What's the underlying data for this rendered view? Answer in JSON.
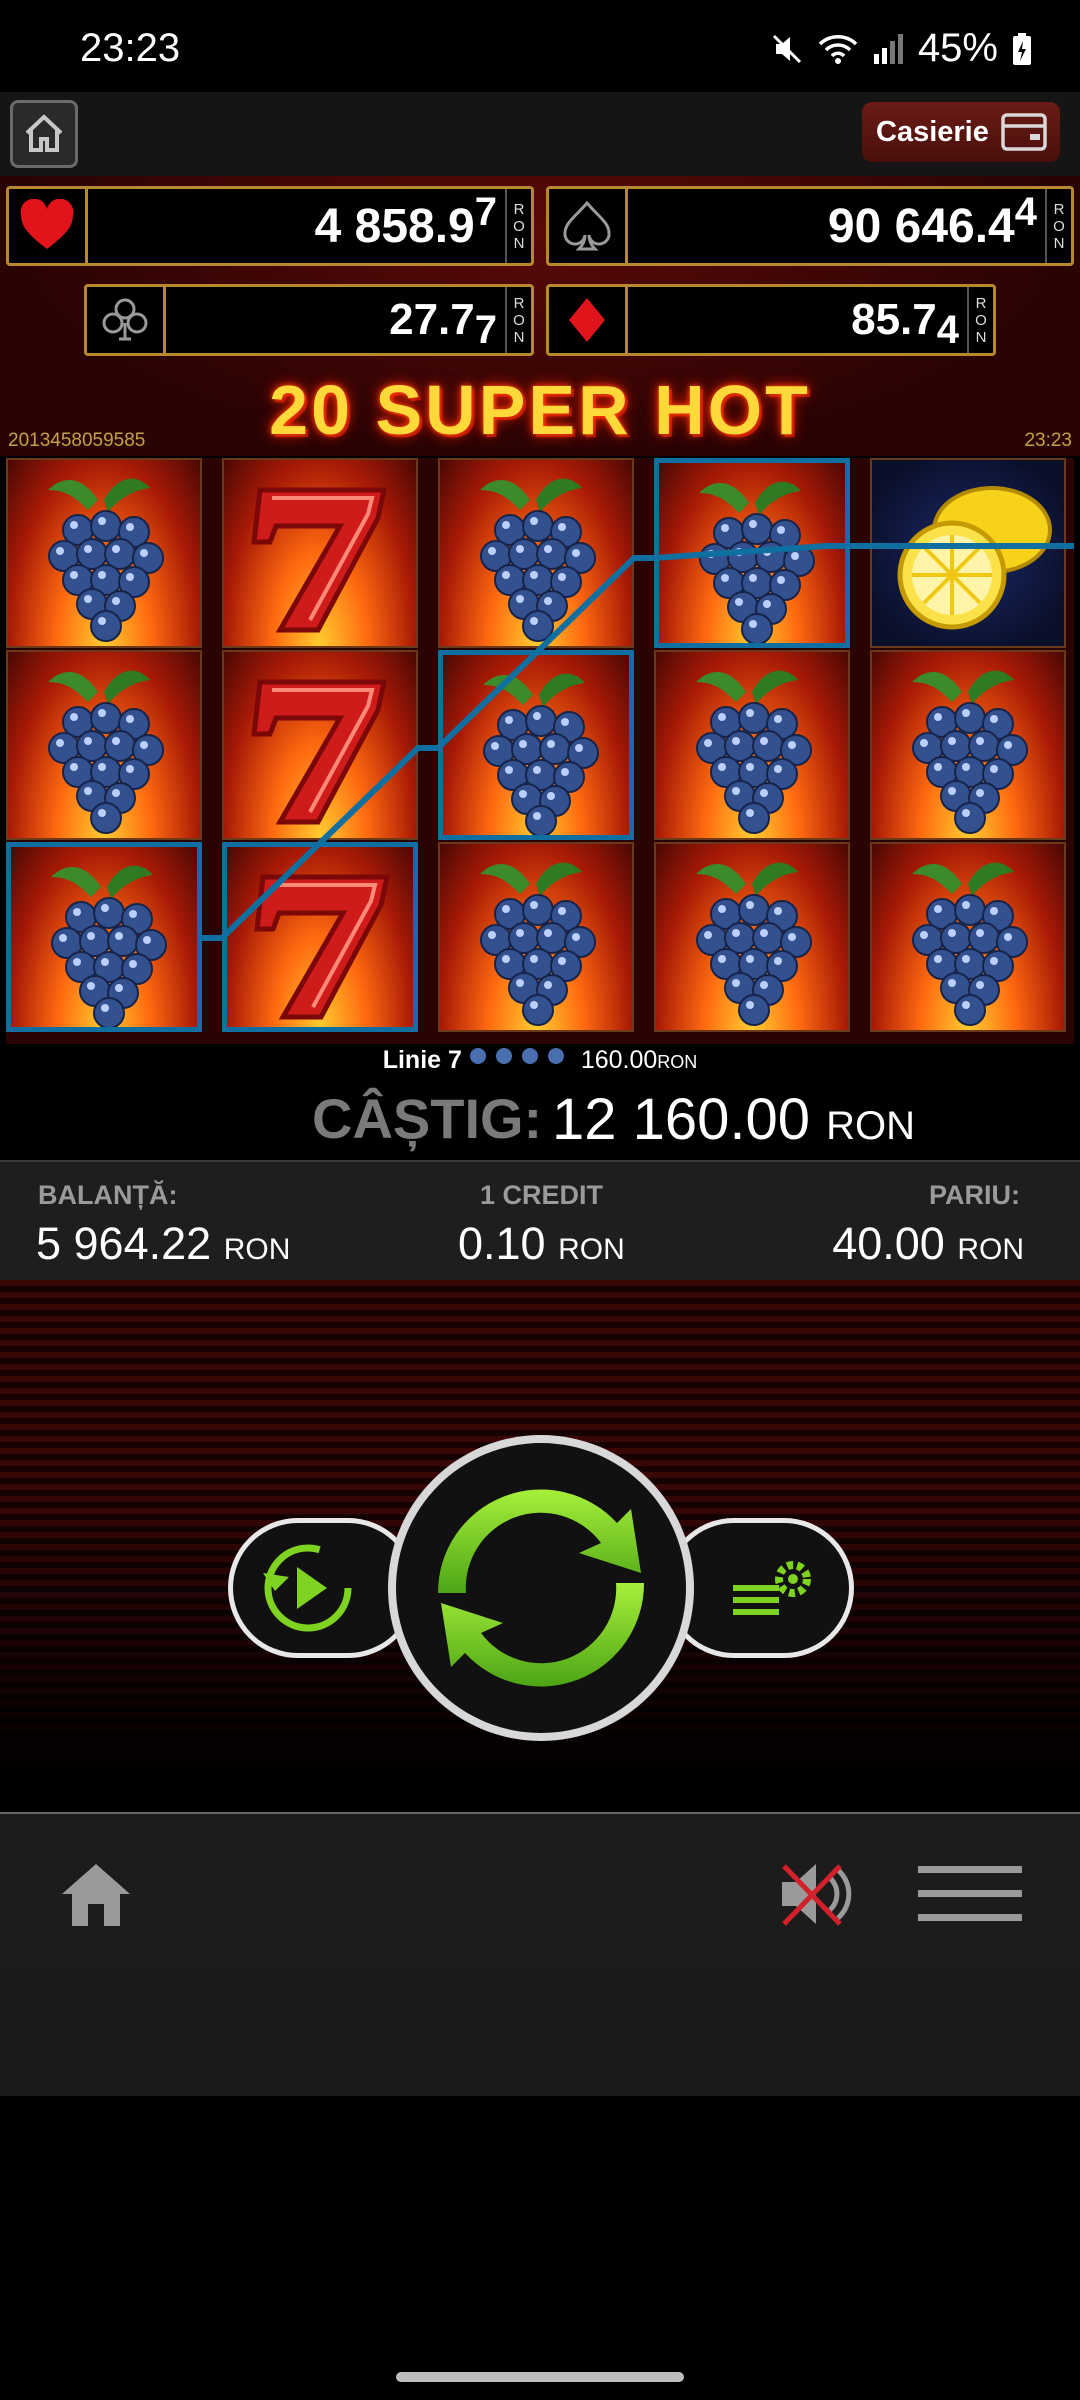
{
  "status_bar": {
    "time": "23:23",
    "battery": "45%",
    "icons": [
      "mute-icon",
      "wifi-icon",
      "signal-icon",
      "battery-icon"
    ]
  },
  "top_bar": {
    "home_icon": "home-icon",
    "cashier_label": "Casierie",
    "cashier_icon": "wallet-icon"
  },
  "jackpots": [
    {
      "suit": "heart",
      "value": "4 858.9",
      "last_digit": "7",
      "currency": [
        "R",
        "O",
        "N"
      ]
    },
    {
      "suit": "spade",
      "value": "90 646.4",
      "last_digit": "4",
      "currency": [
        "R",
        "O",
        "N"
      ]
    },
    {
      "suit": "club",
      "value": "27.7",
      "last_digit": "7",
      "currency": [
        "R",
        "O",
        "N"
      ]
    },
    {
      "suit": "diamond",
      "value": "85.7",
      "last_digit": "4",
      "currency": [
        "R",
        "O",
        "N"
      ]
    }
  ],
  "game": {
    "title": "20 SUPER HOT",
    "session_id": "2013458059585",
    "clock": "23:23"
  },
  "reels": [
    [
      "grapes",
      "grapes",
      "grapes"
    ],
    [
      "seven",
      "seven",
      "seven"
    ],
    [
      "grapes",
      "grapes",
      "grapes"
    ],
    [
      "grapes",
      "grapes",
      "grapes"
    ],
    [
      "lemon",
      "grapes",
      "grapes"
    ]
  ],
  "win_line": {
    "label": "Linie 7",
    "amount": "160.00",
    "currency": "RON"
  },
  "win": {
    "label": "CÂȘTIG:",
    "amount": "12 160.00",
    "currency": "RON"
  },
  "balance": {
    "label": "BALANȚĂ:",
    "value": "5 964.22",
    "currency": "RON"
  },
  "credit": {
    "label": "1 CREDIT",
    "value": "0.10",
    "currency": "RON"
  },
  "bet": {
    "label": "PARIU:",
    "value": "40.00",
    "currency": "RON"
  },
  "controls": {
    "autoplay_icon": "autoplay-icon",
    "spin_icon": "spin-icon",
    "settings_icon": "bet-settings-icon"
  },
  "bottom_bar": {
    "home_icon": "home-icon",
    "sound_icon": "sound-muted-icon",
    "menu_icon": "hamburger-menu-icon"
  }
}
